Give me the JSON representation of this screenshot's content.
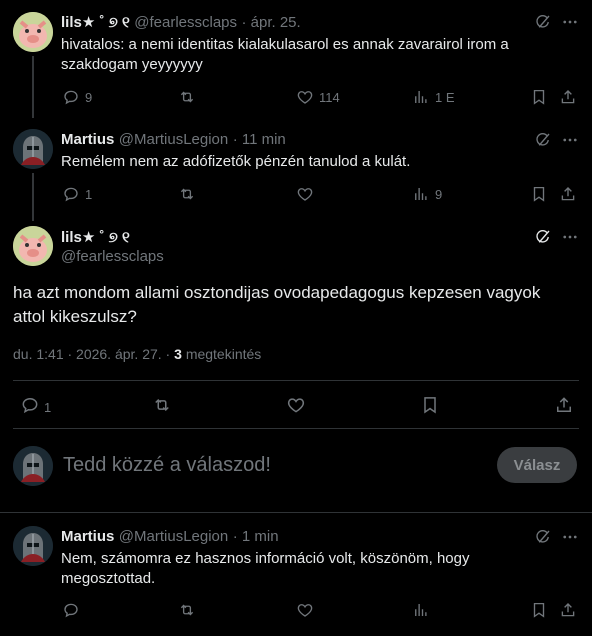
{
  "posts": [
    {
      "name": "lils★ ˚ ୭ ୧",
      "handle": "@fearlessclaps",
      "time": "· ápr. 25.",
      "text_line1": "hivatalos: a nemi identitas kialakulasarol es annak zavarairol irom a",
      "text_line2": "szakdogam yeyyyyyy",
      "replies": "9",
      "likes": "114",
      "views": "1 E"
    },
    {
      "name": "Martius",
      "handle": "@MartiusLegion",
      "time": "· 11 min",
      "text_line1": "Remélem nem az adófizetők pénzén tanulod a kulát.",
      "replies": "1",
      "views": "9"
    }
  ],
  "main_post": {
    "name": "lils★ ˚ ୭ ୧",
    "handle": "@fearlessclaps",
    "text_line1": "ha azt mondom allami osztondijas ovodapedagogus kepzesen vagyok",
    "text_line2": "attol kikeszulsz?",
    "timestamp": "du. 1:41 · 2026. ápr. 27. ·",
    "views_count": "3",
    "views_label": "megtekintés",
    "replies": "1"
  },
  "composer": {
    "placeholder": "Tedd közzé a válaszod!",
    "reply_button": "Válasz"
  },
  "reply": {
    "name": "Martius",
    "handle": "@MartiusLegion",
    "time": "· 1 min",
    "text_line1": "Nem, számomra ez hasznos információ volt, köszönöm, hogy",
    "text_line2": "megosztottad."
  }
}
